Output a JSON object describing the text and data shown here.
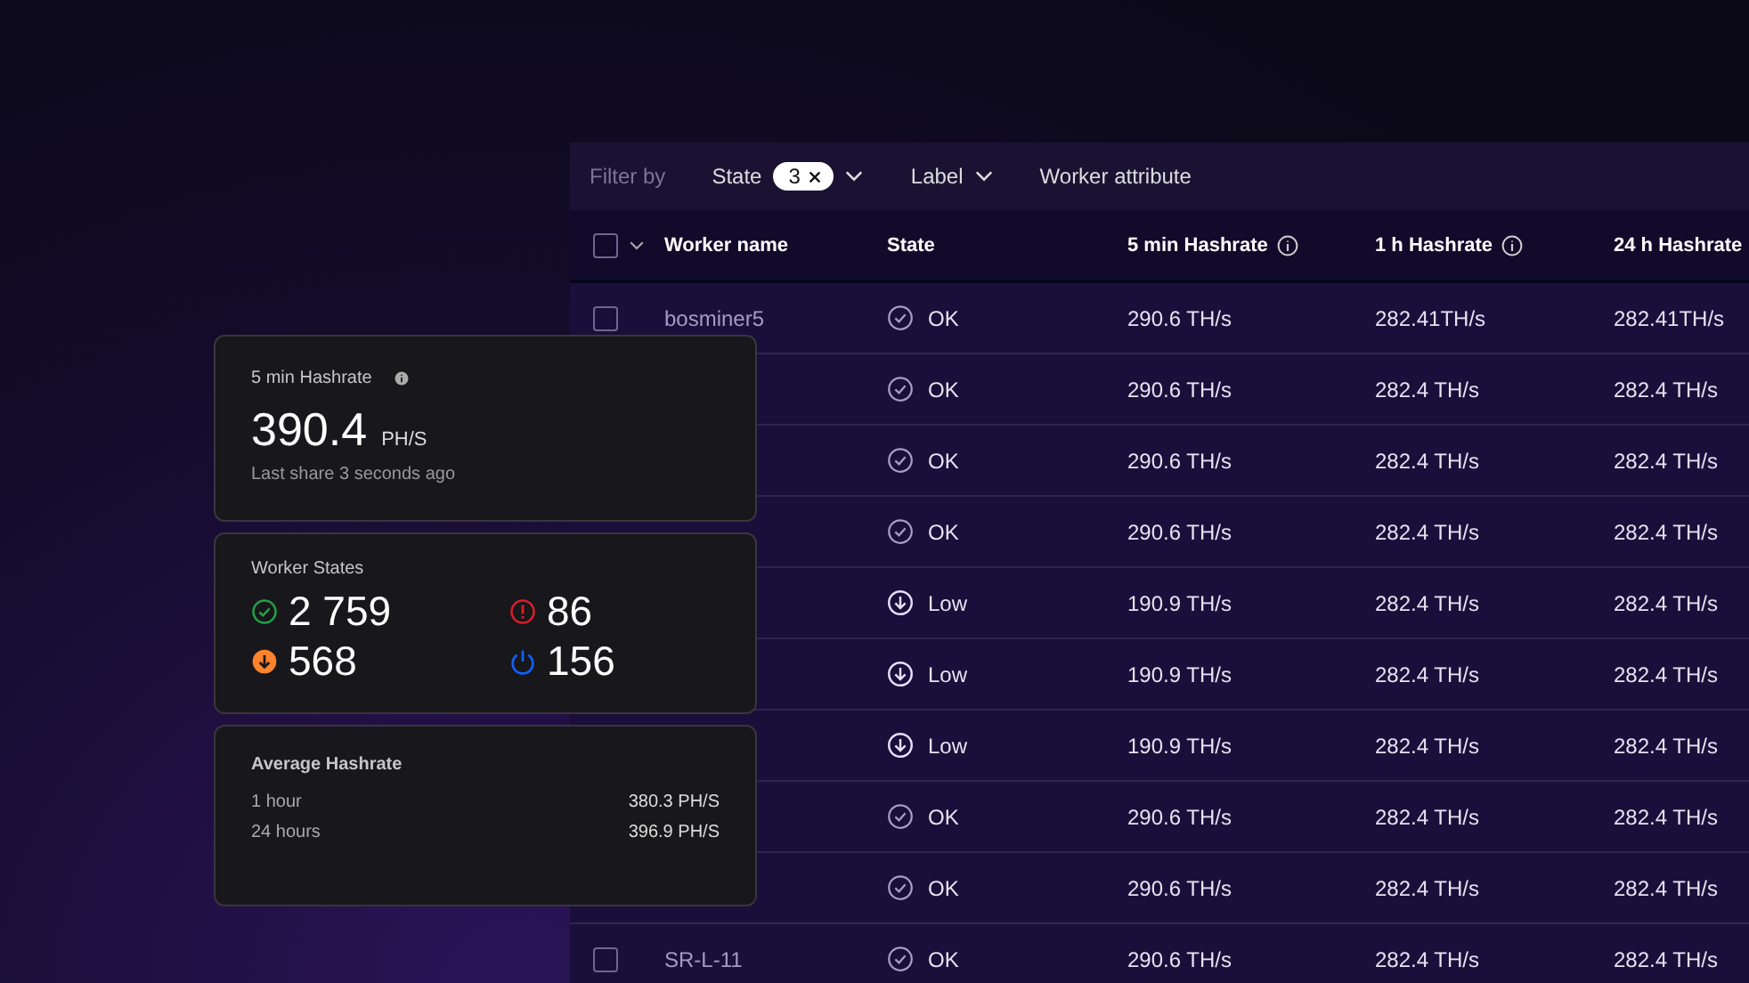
{
  "filter_bar": {
    "label": "Filter by",
    "filters": [
      {
        "label": "State",
        "count": "3"
      },
      {
        "label": "Label"
      },
      {
        "label": "Worker attribute",
        "has_dropdown": false
      }
    ]
  },
  "table": {
    "select_all_checked": false,
    "columns": [
      "Worker name",
      "State",
      "5 min Hashrate",
      "1 h Hashrate",
      "24 h Hashrate"
    ],
    "rows": [
      {
        "name": "bosminer5",
        "state": "OK",
        "kind": "ok",
        "h5": "290.6 TH/s",
        "h1": "282.41TH/s",
        "h24": "282.41TH/s",
        "checked": false
      },
      {
        "state": "OK",
        "kind": "ok",
        "h5": "290.6 TH/s",
        "h1": "282.4 TH/s",
        "h24": "282.4 TH/s"
      },
      {
        "state": "OK",
        "kind": "ok",
        "h5": "290.6 TH/s",
        "h1": "282.4 TH/s",
        "h24": "282.4 TH/s"
      },
      {
        "state": "OK",
        "kind": "ok",
        "h5": "290.6 TH/s",
        "h1": "282.4 TH/s",
        "h24": "282.4 TH/s"
      },
      {
        "state": "Low",
        "kind": "low",
        "h5": "190.9 TH/s",
        "h1": "282.4 TH/s",
        "h24": "282.4 TH/s"
      },
      {
        "state": "Low",
        "kind": "low",
        "h5": "190.9 TH/s",
        "h1": "282.4 TH/s",
        "h24": "282.4 TH/s"
      },
      {
        "state": "Low",
        "kind": "low",
        "h5": "190.9 TH/s",
        "h1": "282.4 TH/s",
        "h24": "282.4 TH/s"
      },
      {
        "state": "OK",
        "kind": "ok",
        "h5": "290.6 TH/s",
        "h1": "282.4 TH/s",
        "h24": "282.4 TH/s"
      },
      {
        "state": "OK",
        "kind": "ok",
        "h5": "290.6 TH/s",
        "h1": "282.4 TH/s",
        "h24": "282.4 TH/s"
      },
      {
        "name": "SR-L-11",
        "state": "OK",
        "kind": "ok",
        "h5": "290.6 TH/s",
        "h1": "282.4 TH/s",
        "h24": "282.4 TH/s",
        "checked": false
      }
    ]
  },
  "hashrate_card": {
    "title": "5 min Hashrate",
    "value": "390.4",
    "unit": "PH/S",
    "note": "Last share 3 seconds ago"
  },
  "states_card": {
    "title": "Worker States",
    "items": [
      {
        "kind": "ok",
        "count": "2 759",
        "color": "#24a148"
      },
      {
        "kind": "error",
        "count": "86",
        "color": "#da1e28"
      },
      {
        "kind": "low",
        "count": "568",
        "color": "#ff832b"
      },
      {
        "kind": "off",
        "count": "156",
        "color": "#0f62fe"
      }
    ]
  },
  "average_card": {
    "title": "Average Hashrate",
    "rows": [
      {
        "label": "1 hour",
        "value": "380.3 PH/S"
      },
      {
        "label": "24 hours",
        "value": "396.9 PH/S"
      }
    ]
  }
}
